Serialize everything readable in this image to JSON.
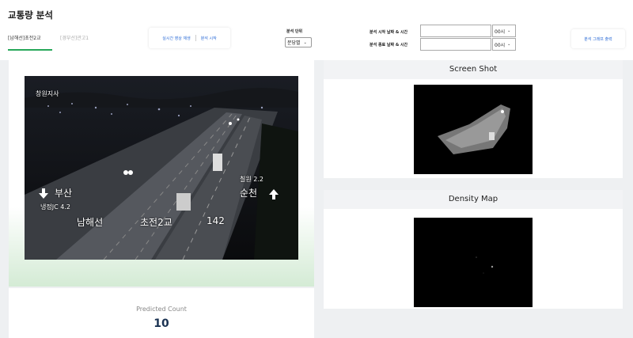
{
  "header": {
    "title": "교통량 분석",
    "tabs": [
      {
        "label": "[남해선]초전2교",
        "active": true
      },
      {
        "label": "[경부선]관고1",
        "active": false
      }
    ],
    "video_buttons": {
      "play_label": "실시간 영상 재생",
      "start_label": "분석 시작"
    },
    "unit": {
      "label": "분석 단위",
      "value": "분당별"
    },
    "start": {
      "label": "분석 시작 날짜 & 시간",
      "value": "",
      "hour": "00시"
    },
    "end": {
      "label": "분석 종료 날짜 & 시간",
      "value": "",
      "hour": "00시"
    },
    "graph_button_label": "분석 그래프 출력"
  },
  "video": {
    "location": "창원지사",
    "left_direction": "부산",
    "left_sub": "냉정JC 4.2",
    "right_sub": "칠원 2.2",
    "right_direction": "순천",
    "road_name": "남해선",
    "spot_name": "초전2교",
    "marker": "142"
  },
  "panels": {
    "screenshot_title": "Screen Shot",
    "density_title": "Density Map"
  },
  "count": {
    "label": "Predicted Count",
    "value": "10"
  }
}
